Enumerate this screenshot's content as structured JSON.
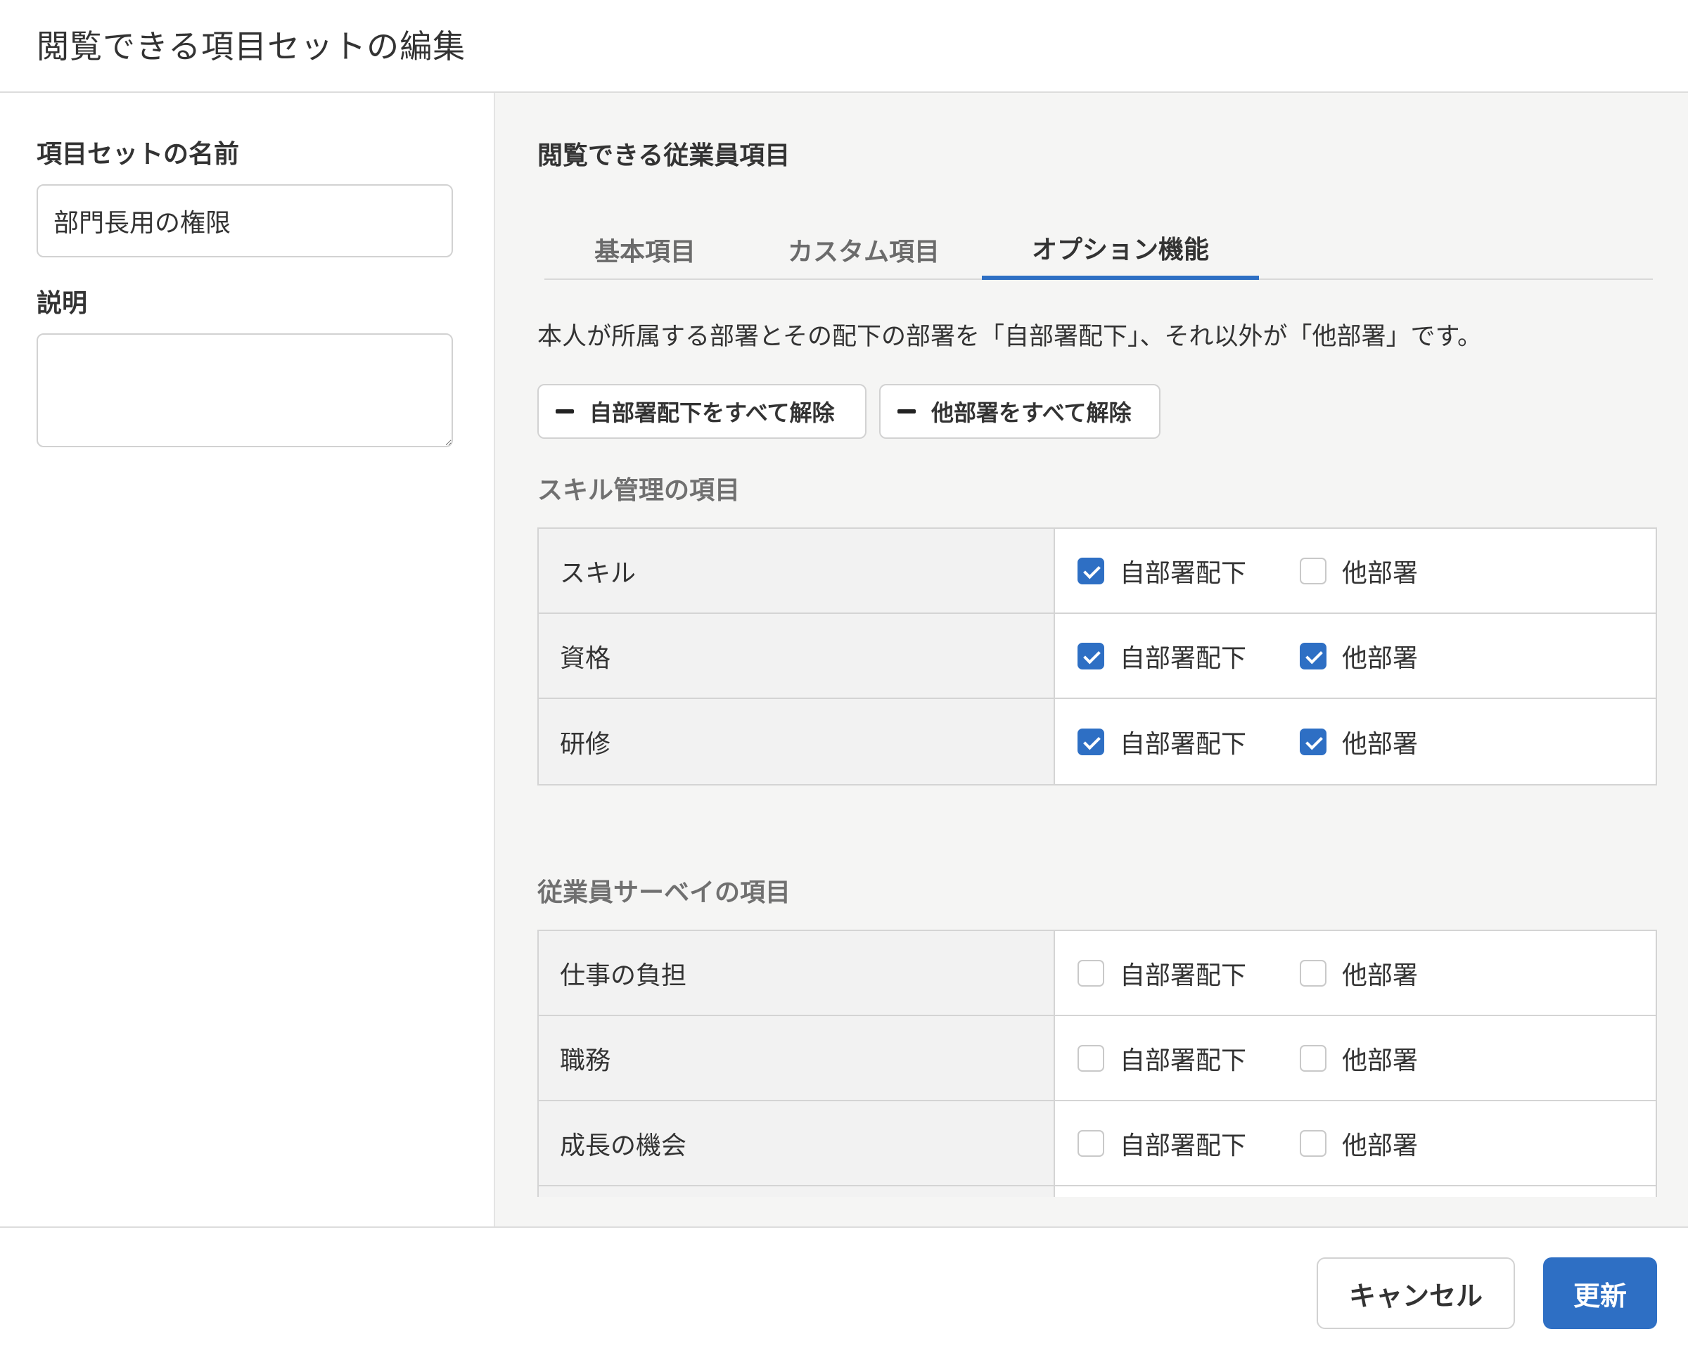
{
  "header": {
    "title": "閲覧できる項目セットの編集"
  },
  "left": {
    "name_label": "項目セットの名前",
    "name_value": "部門長用の権限",
    "desc_label": "説明",
    "desc_value": ""
  },
  "right": {
    "title": "閲覧できる従業員項目",
    "tabs": [
      {
        "label": "基本項目",
        "active": false
      },
      {
        "label": "カスタム項目",
        "active": false
      },
      {
        "label": "オプション機能",
        "active": true
      }
    ],
    "description": "本人が所属する部署とその配下の部署を「自部署配下」、それ以外が「他部署」です。",
    "clear_own_label": "自部署配下をすべて解除",
    "clear_other_label": "他部署をすべて解除",
    "col_own": "自部署配下",
    "col_other": "他部署",
    "groups": [
      {
        "title": "スキル管理の項目",
        "rows": [
          {
            "label": "スキル",
            "own": true,
            "other": false
          },
          {
            "label": "資格",
            "own": true,
            "other": true
          },
          {
            "label": "研修",
            "own": true,
            "other": true
          }
        ]
      },
      {
        "title": "従業員サーベイの項目",
        "rows": [
          {
            "label": "仕事の負担",
            "own": false,
            "other": false
          },
          {
            "label": "職務",
            "own": false,
            "other": false
          },
          {
            "label": "成長の機会",
            "own": false,
            "other": false
          },
          {
            "label": "",
            "own": false,
            "other": false
          }
        ]
      }
    ]
  },
  "footer": {
    "cancel_label": "キャンセル",
    "submit_label": "更新"
  },
  "colors": {
    "accent": "#2e6fc4",
    "panel_bg": "#f5f5f4",
    "label_bg": "#f2f2f2"
  }
}
